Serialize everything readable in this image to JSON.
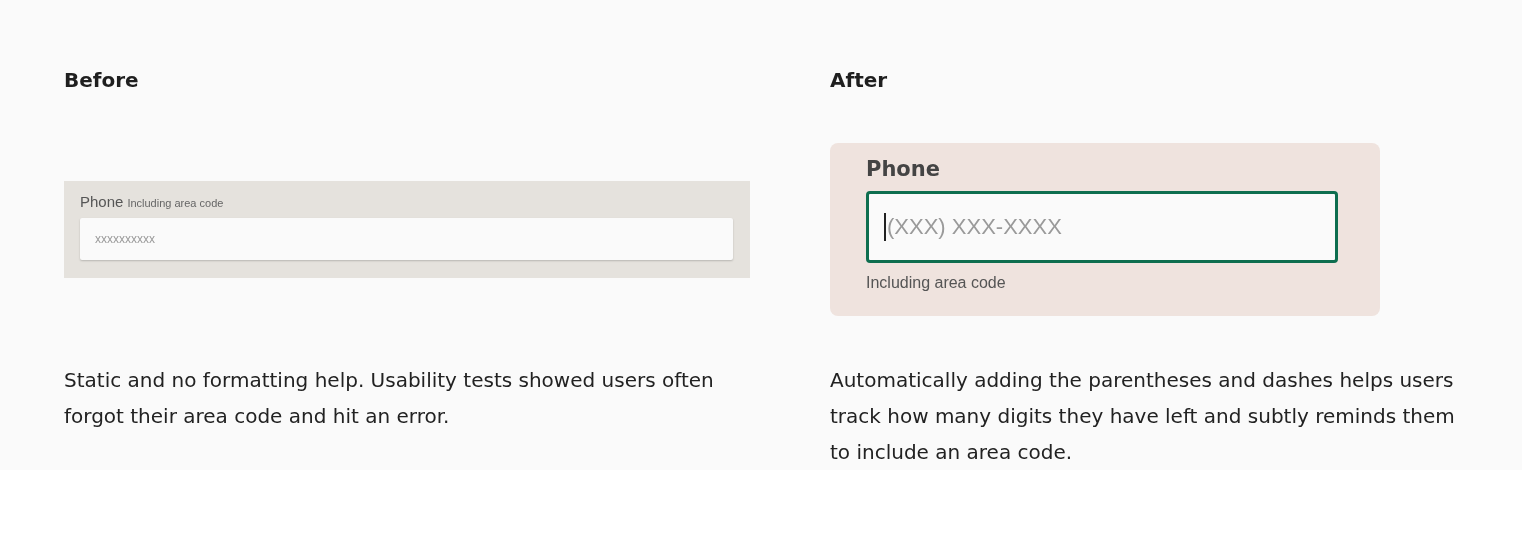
{
  "panels": [
    {
      "heading": "Before",
      "kind": "inline-hint",
      "field": {
        "label": "Phone",
        "hint": "Including area code",
        "placeholder": "xxxxxxxxxx",
        "focused": false
      },
      "description": "Static and no formatting help. Usability tests showed users often forgot their area code and hit an error."
    },
    {
      "heading": "After",
      "kind": "below-hint",
      "field": {
        "label": "Phone",
        "hint": "Including area code",
        "placeholder": "(XXX) XXX-XXXX",
        "focused": true
      },
      "description": "Automatically adding the parentheses and dashes helps users track how many digits they have left and subtly reminds them to include an area code."
    }
  ]
}
